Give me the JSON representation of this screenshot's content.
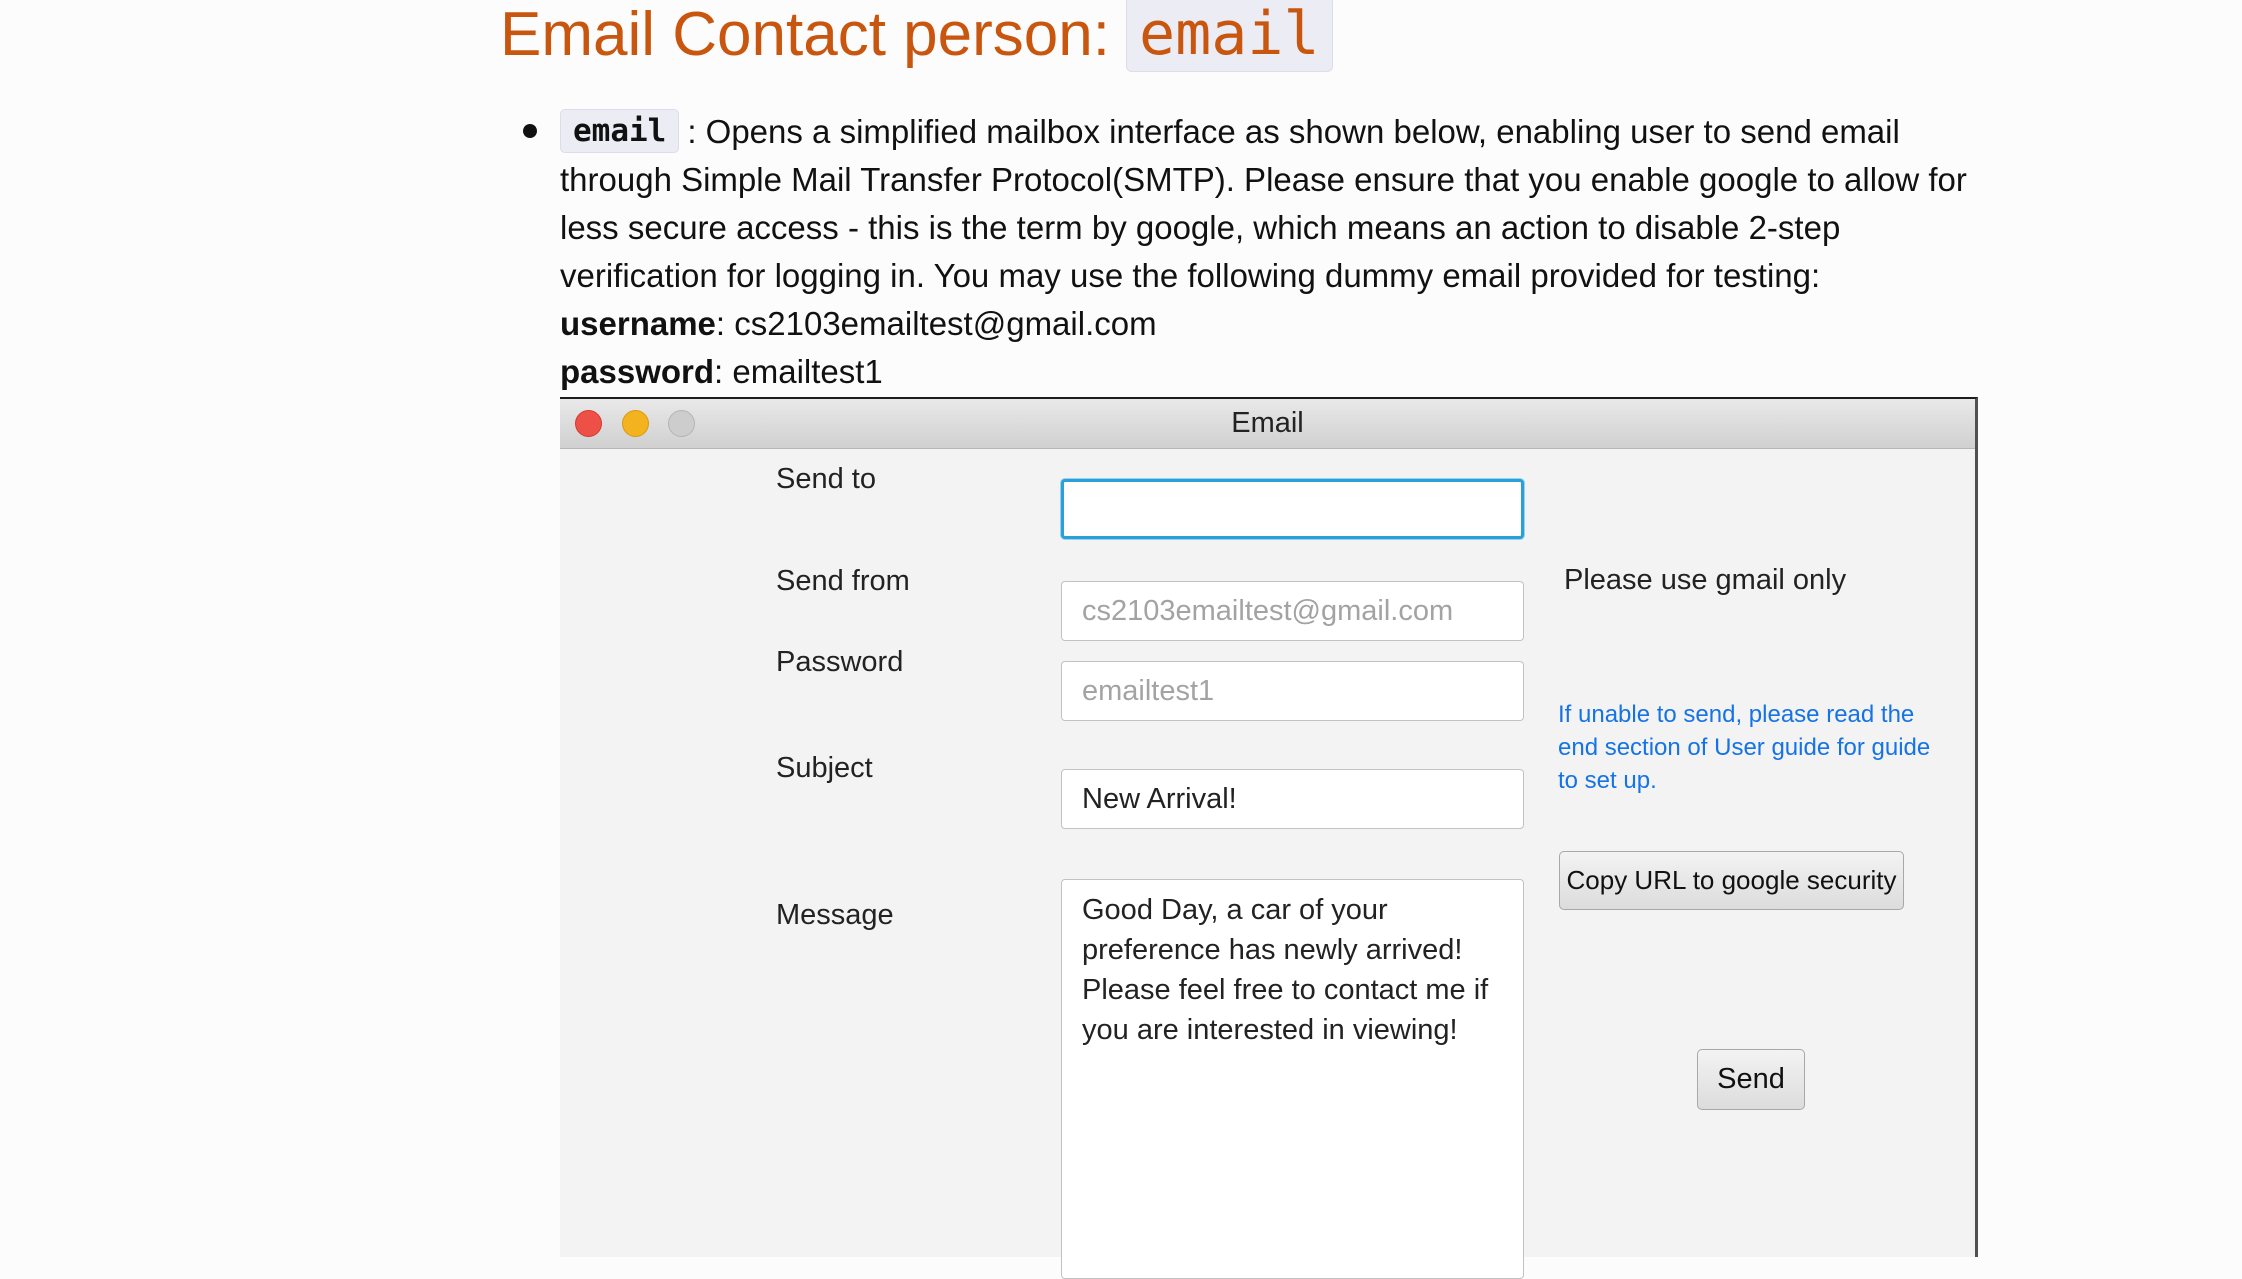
{
  "document": {
    "heading": {
      "text": "Email Contact person:",
      "code": "email"
    },
    "bullet": {
      "code": "email",
      "lines": [
        ": Opens a simplified mailbox interface as shown below, enabling user to send email",
        "through Simple Mail Transfer Protocol(SMTP). Please ensure that you enable google to allow for",
        "less secure access - this is the term by google, which means an action to disable 2-step",
        "verification for logging in. You may use the following dummy email provided for testing:"
      ],
      "username_label": "username",
      "username_value": ": cs2103emailtest@gmail.com",
      "password_label": "password",
      "password_value": ": emailtest1"
    }
  },
  "window": {
    "title": "Email",
    "traffic_lights": {
      "close": "#ec5046",
      "minimize": "#f3b31f",
      "maximize": "#cdcdcd"
    },
    "form": {
      "send_to": {
        "label": "Send to",
        "value": ""
      },
      "send_from": {
        "label": "Send from",
        "placeholder": "cs2103emailtest@gmail.com"
      },
      "password": {
        "label": "Password",
        "placeholder": "emailtest1"
      },
      "subject": {
        "label": "Subject",
        "value": "New Arrival!"
      },
      "message": {
        "label": "Message",
        "lines": [
          "Good Day, a car of your",
          "preference has newly arrived!",
          "Please feel free to contact me if",
          "you are interested in viewing!"
        ]
      }
    },
    "hint": "Please use gmail only",
    "help_lines": [
      "If unable to send, please read the",
      "end section of User guide for guide",
      "to set up."
    ],
    "copy_button_label": "Copy URL to google security",
    "send_button_label": "Send",
    "focus_color": "#2a9fd8",
    "help_color": "#1673e6"
  }
}
